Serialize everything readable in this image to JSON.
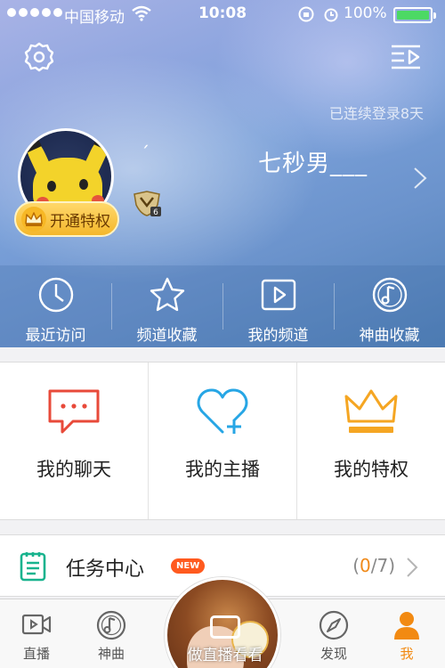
{
  "status_bar": {
    "carrier": "中国移动",
    "time": "10:08",
    "battery": "100%"
  },
  "header": {
    "login_days": "已连续登录8天",
    "nickname_prefix": "ˊ",
    "nickname": "七秒男___",
    "vip_button": "开通特权",
    "level_badge": "6"
  },
  "quick_actions": [
    {
      "label": "最近访问",
      "icon": "clock-icon"
    },
    {
      "label": "频道收藏",
      "icon": "star-icon"
    },
    {
      "label": "我的频道",
      "icon": "play-channel-icon"
    },
    {
      "label": "神曲收藏",
      "icon": "music-note-icon"
    }
  ],
  "features": [
    {
      "label": "我的聊天",
      "icon": "chat-bubble-icon",
      "color": "#e84a3a"
    },
    {
      "label": "我的主播",
      "icon": "heart-plus-icon",
      "color": "#27a6e5"
    },
    {
      "label": "我的特权",
      "icon": "crown-icon",
      "color": "#f5a623"
    }
  ],
  "task_center": {
    "title": "任务中心",
    "badge": "NEW",
    "open": "(",
    "done": "0",
    "total": "/7)",
    "accent": "#f08a1a"
  },
  "tab_bar": {
    "tabs": [
      {
        "label": "直播",
        "icon": "video-icon"
      },
      {
        "label": "神曲",
        "icon": "music-disc-icon"
      },
      {
        "label": "发现",
        "icon": "compass-icon"
      },
      {
        "label": "我",
        "icon": "person-icon",
        "active": true
      }
    ],
    "center_label": "做直播看看",
    "accent": "#f28a12"
  }
}
